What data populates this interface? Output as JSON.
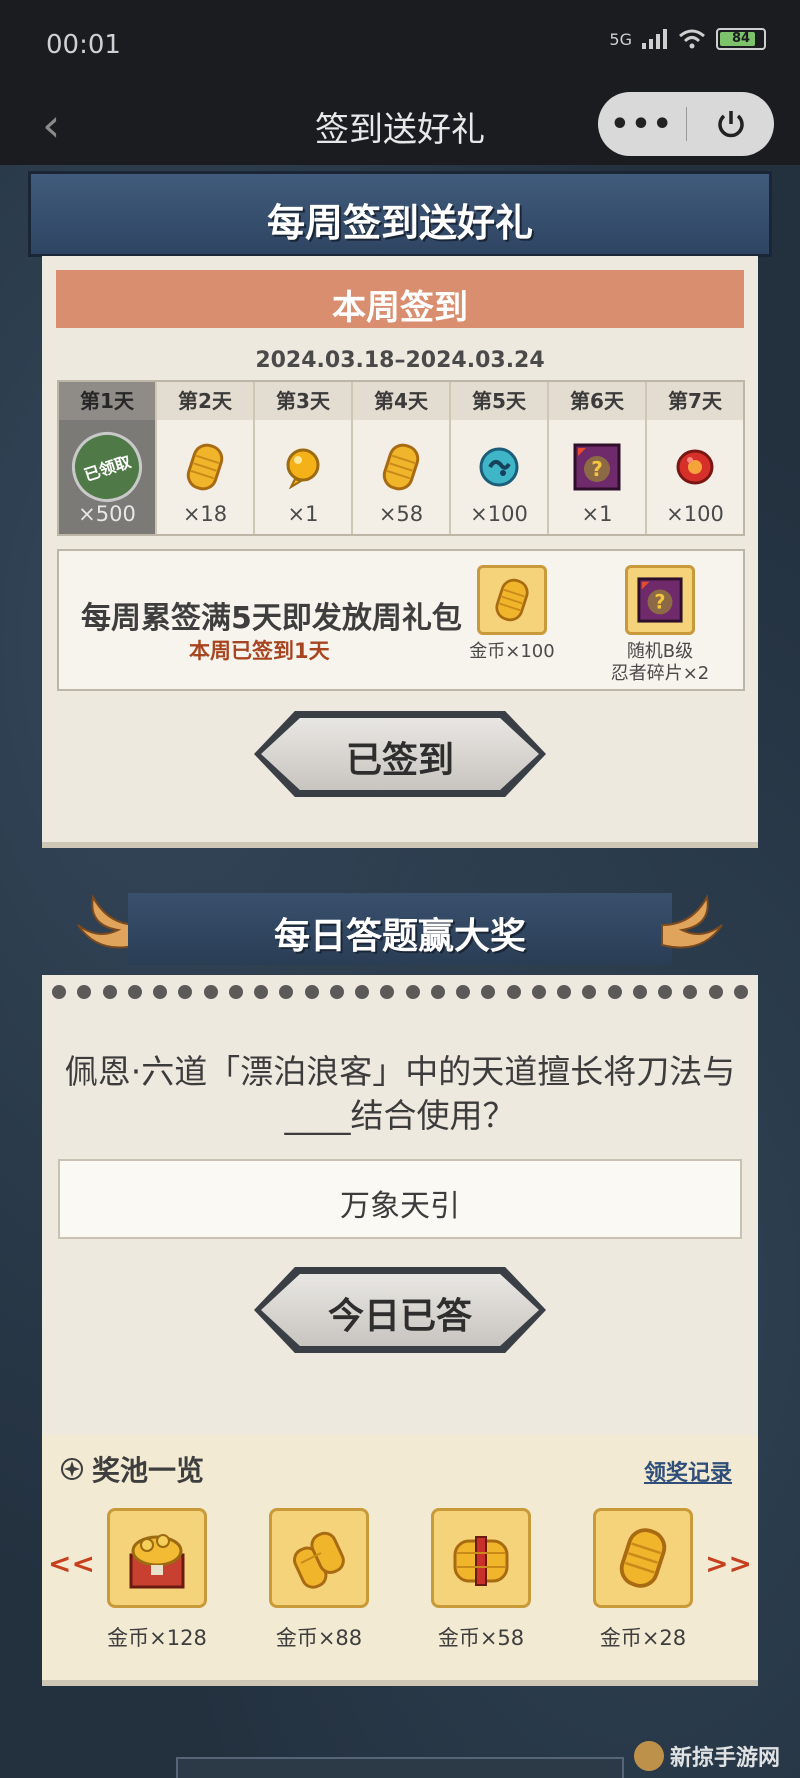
{
  "status_bar": {
    "time": "00:01",
    "network": "5G",
    "battery": "84",
    "battery_level": 0.84
  },
  "nav": {
    "title": "签到送好礼",
    "more_label": "•••"
  },
  "weekly": {
    "banner_title": "每周签到送好礼",
    "header_title": "本周签到",
    "date_range": "2024.03.18–2024.03.24",
    "claimed_stamp": "已领取",
    "days": [
      {
        "label": "第1天",
        "qty": "×500",
        "icon": "coin-pile-icon",
        "claimed": true
      },
      {
        "label": "第2天",
        "qty": "×18",
        "icon": "gold-coin-icon",
        "claimed": false
      },
      {
        "label": "第3天",
        "qty": "×1",
        "icon": "gold-orb-icon",
        "claimed": false
      },
      {
        "label": "第4天",
        "qty": "×58",
        "icon": "gold-coin-icon",
        "claimed": false
      },
      {
        "label": "第5天",
        "qty": "×100",
        "icon": "blue-orb-icon",
        "claimed": false
      },
      {
        "label": "第6天",
        "qty": "×1",
        "icon": "mystery-ninja-fragment-icon",
        "claimed": false
      },
      {
        "label": "第7天",
        "qty": "×100",
        "icon": "red-gem-icon",
        "claimed": false
      }
    ],
    "bonus_desc": "每周累签满5天即发放周礼包",
    "bonus_progress": "本周已签到1天",
    "bonus_rewards": [
      {
        "label": "金币×100",
        "icon": "gold-coin-icon"
      },
      {
        "label": "随机B级\n忍者碎片×2",
        "icon": "mystery-ninja-fragment-icon"
      }
    ],
    "signed_button": "已签到"
  },
  "quiz": {
    "banner_title": "每日答题赢大奖",
    "question": "佩恩·六道「漂泊浪客」中的天道擅长将刀法与____结合使用？",
    "answer": "万象天引",
    "answered_button": "今日已答",
    "pool_title": "奖池一览",
    "pool_record": "领奖记录",
    "pool_items": [
      {
        "label": "金币×128",
        "icon": "coin-chest-icon"
      },
      {
        "label": "金币×88",
        "icon": "coin-stack-icon"
      },
      {
        "label": "金币×58",
        "icon": "coin-bundle-icon"
      },
      {
        "label": "金币×28",
        "icon": "gold-coin-icon"
      }
    ]
  },
  "watermark": "新掠手游网"
}
